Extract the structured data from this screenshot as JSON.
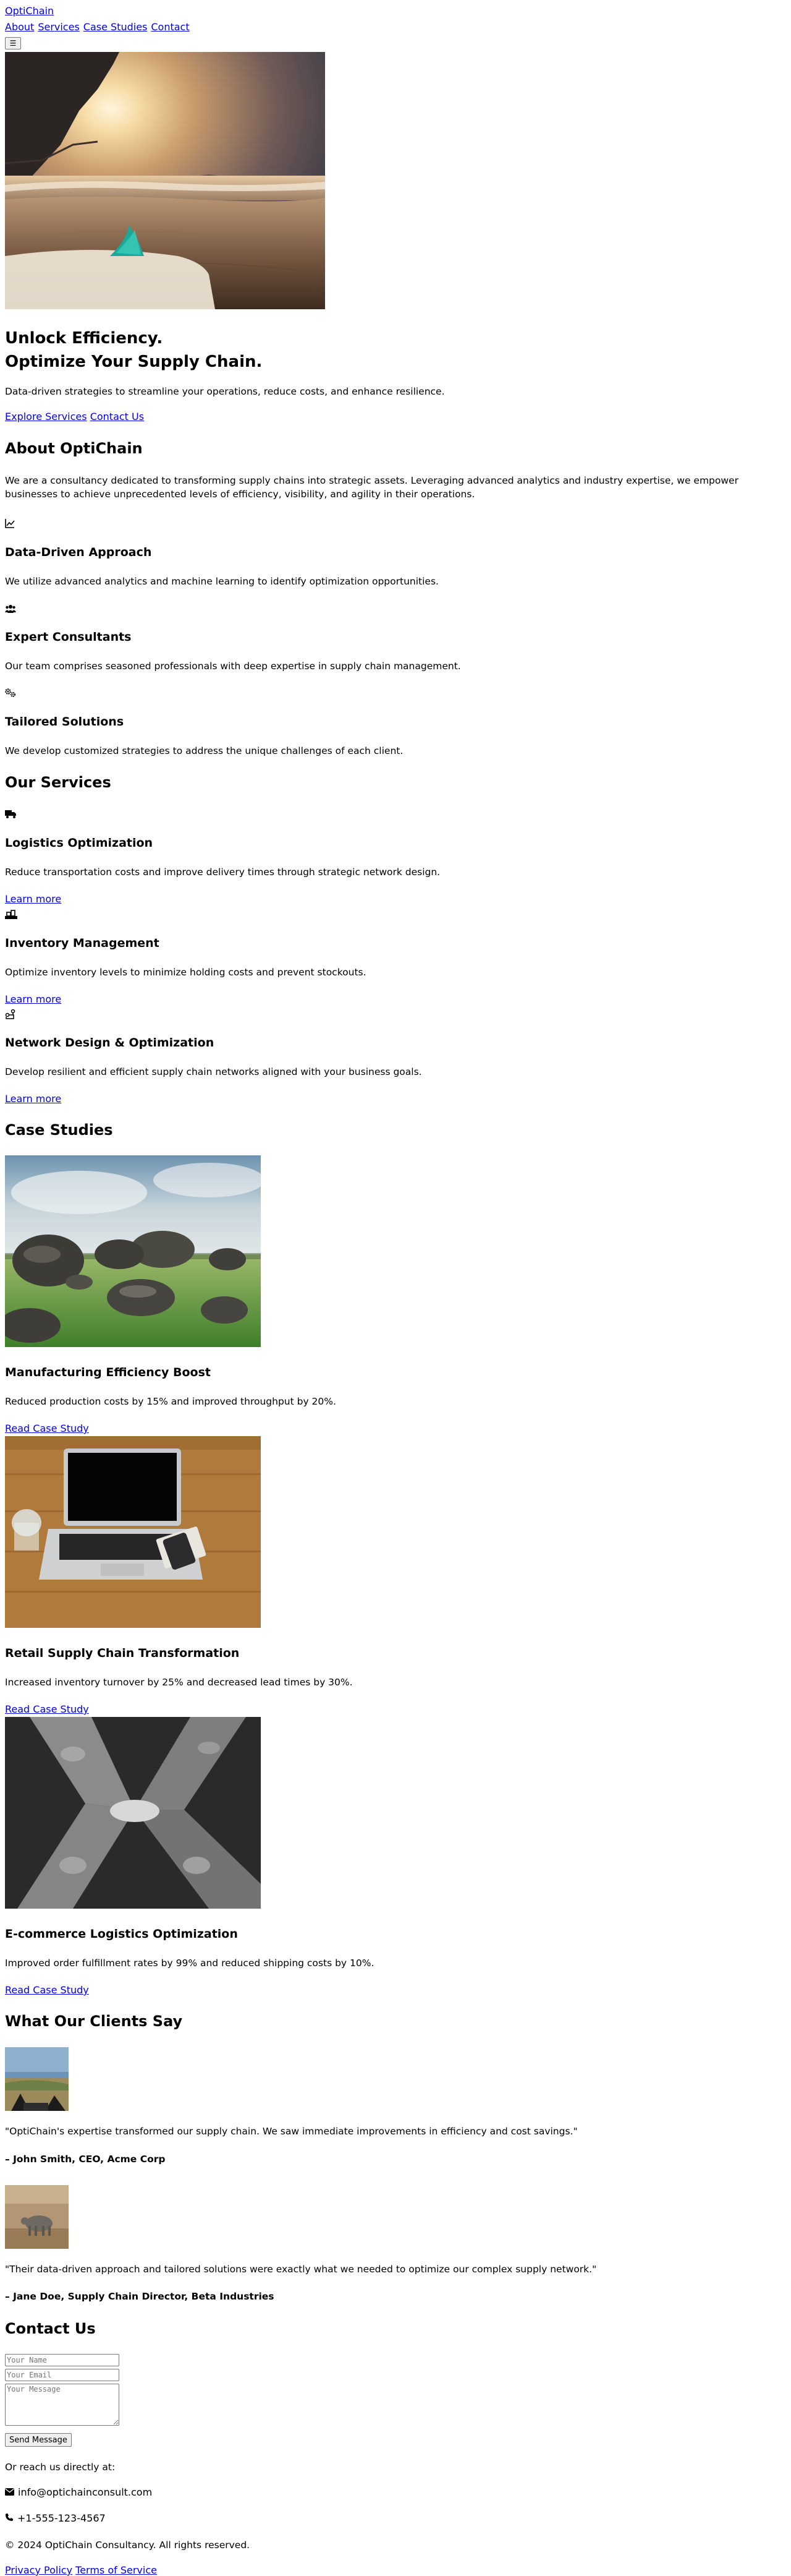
{
  "header": {
    "brand": "OptiChain",
    "nav": [
      "About",
      "Services",
      "Case Studies",
      "Contact"
    ],
    "menu_icon": "menu-icon"
  },
  "hero": {
    "title_line1": "Unlock Efficiency.",
    "title_line2": "Optimize Your Supply Chain.",
    "subtitle": "Data-driven strategies to streamline your operations, reduce costs, and enhance resilience.",
    "cta_primary": "Explore Services",
    "cta_secondary": "Contact Us"
  },
  "about": {
    "heading": "About OptiChain",
    "text": "We are a consultancy dedicated to transforming supply chains into strategic assets. Leveraging advanced analytics and industry expertise, we empower businesses to achieve unprecedented levels of efficiency, visibility, and agility in their operations.",
    "features": [
      {
        "icon": "chart-line-icon",
        "title": "Data-Driven Approach",
        "text": "We utilize advanced analytics and machine learning to identify optimization opportunities."
      },
      {
        "icon": "users-icon",
        "title": "Expert Consultants",
        "text": "Our team comprises seasoned professionals with deep expertise in supply chain management."
      },
      {
        "icon": "gears-icon",
        "title": "Tailored Solutions",
        "text": "We develop customized strategies to address the unique challenges of each client."
      }
    ]
  },
  "services": {
    "heading": "Our Services",
    "items": [
      {
        "icon": "truck-icon",
        "title": "Logistics Optimization",
        "text": "Reduce transportation costs and improve delivery times through strategic network design.",
        "link": "Learn more"
      },
      {
        "icon": "warehouse-icon",
        "title": "Inventory Management",
        "text": "Optimize inventory levels to minimize holding costs and prevent stockouts.",
        "link": "Learn more"
      },
      {
        "icon": "network-icon",
        "title": "Network Design & Optimization",
        "text": "Develop resilient and efficient supply chain networks aligned with your business goals.",
        "link": "Learn more"
      }
    ]
  },
  "case_studies": {
    "heading": "Case Studies",
    "items": [
      {
        "image": "rocks-field-image",
        "title": "Manufacturing Efficiency Boost",
        "text": "Reduced production costs by 15% and improved throughput by 20%.",
        "link": "Read Case Study"
      },
      {
        "image": "laptop-desk-image",
        "title": "Retail Supply Chain Transformation",
        "text": "Increased inventory turnover by 25% and decreased lead times by 30%.",
        "link": "Read Case Study"
      },
      {
        "image": "architecture-image",
        "title": "E-commerce Logistics Optimization",
        "text": "Improved order fulfillment rates by 99% and reduced shipping costs by 10%.",
        "link": "Read Case Study"
      }
    ]
  },
  "testimonials": {
    "heading": "What Our Clients Say",
    "items": [
      {
        "avatar": "client-photo-1",
        "quote": "\"OptiChain's expertise transformed our supply chain. We saw immediate improvements in efficiency and cost savings.\"",
        "author": "– John Smith, CEO, Acme Corp"
      },
      {
        "avatar": "client-photo-2",
        "quote": "\"Their data-driven approach and tailored solutions were exactly what we needed to optimize our complex supply network.\"",
        "author": "– Jane Doe, Supply Chain Director, Beta Industries"
      }
    ]
  },
  "contact": {
    "heading": "Contact Us",
    "name_placeholder": "Your Name",
    "email_placeholder": "Your Email",
    "message_placeholder": "Your Message",
    "send_label": "Send Message",
    "direct_text": "Or reach us directly at:",
    "email": "info@optichainconsult.com",
    "phone": "+1-555-123-4567"
  },
  "footer": {
    "copyright": "© 2024 OptiChain Consultancy. All rights reserved.",
    "links": [
      "Privacy Policy",
      "Terms of Service"
    ]
  }
}
